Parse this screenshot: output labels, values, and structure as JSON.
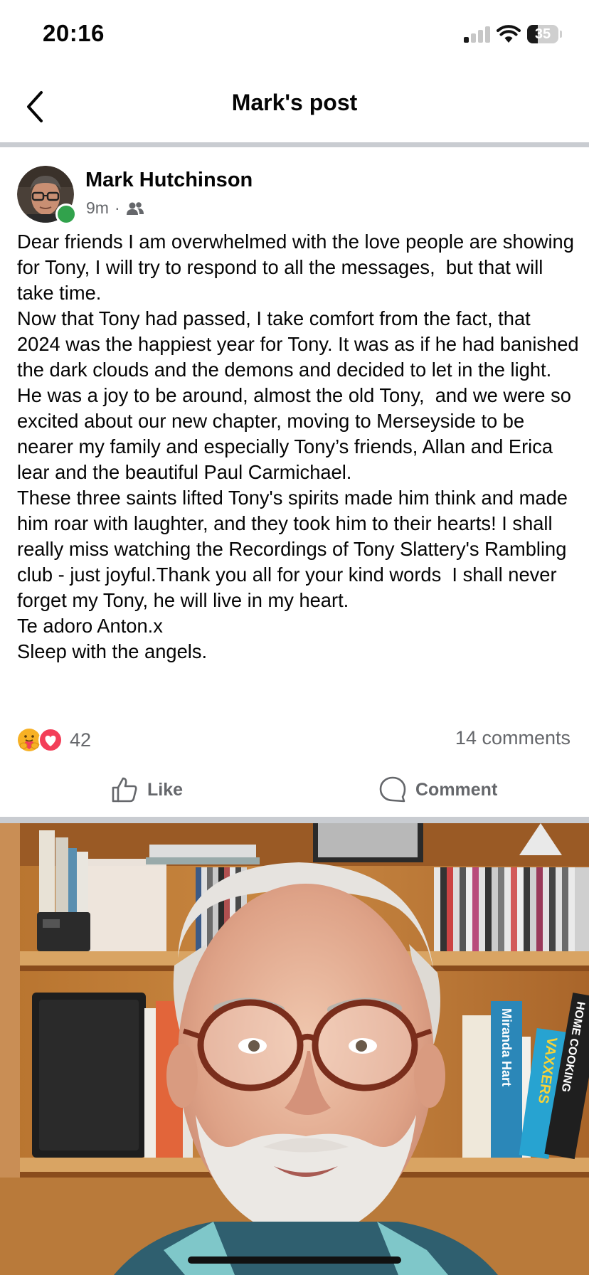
{
  "status_bar": {
    "time": "20:16",
    "battery": "35",
    "battery_level": 0.35,
    "icons": [
      "cellular-signal-icon",
      "wifi-icon",
      "battery-icon"
    ]
  },
  "header": {
    "title": "Mark's post",
    "back_icon": "chevron-left-icon"
  },
  "post": {
    "author": "Mark Hutchinson",
    "time_ago": "9m",
    "separator": "·",
    "audience_icon": "friends-icon",
    "body": [
      "Dear friends I am overwhelmed with the love people are showing for Tony, I will try to respond to all the messages,  but that will take time.",
      "Now that Tony had passed, I take comfort from the fact, that 2024 was the happiest year for Tony. It was as if he had banished the dark clouds and the demons and decided to let in the light. He was a joy to be around, almost the old Tony,  and we were so excited about our new chapter, moving to Merseyside to be nearer my family and especially Tony’s friends, Allan and Erica lear and the beautiful Paul Carmichael.",
      "These three saints lifted Tony's spirits made him think and made him roar with laughter, and they took him to their hearts! I shall really miss watching the Recordings of Tony Slattery's Rambling club - just joyful.Thank you all for your kind words  I shall never forget my Tony, he will live in my heart.",
      "Te adoro Anton.x",
      "Sleep with the angels."
    ],
    "reactions": {
      "icons": [
        "care-reaction-icon",
        "love-reaction-icon"
      ],
      "count": "42"
    },
    "comments_count": "14 comments",
    "actions": {
      "like": "Like",
      "comment": "Comment"
    },
    "photo": {
      "book_titles": [
        "Miranda Hart",
        "VAXXERS",
        "HOME COOKING"
      ]
    }
  },
  "colors": {
    "secondary_text": "#65676b",
    "divider": "#c9ccd1",
    "online": "#31a24c",
    "love": "#f33e58"
  }
}
